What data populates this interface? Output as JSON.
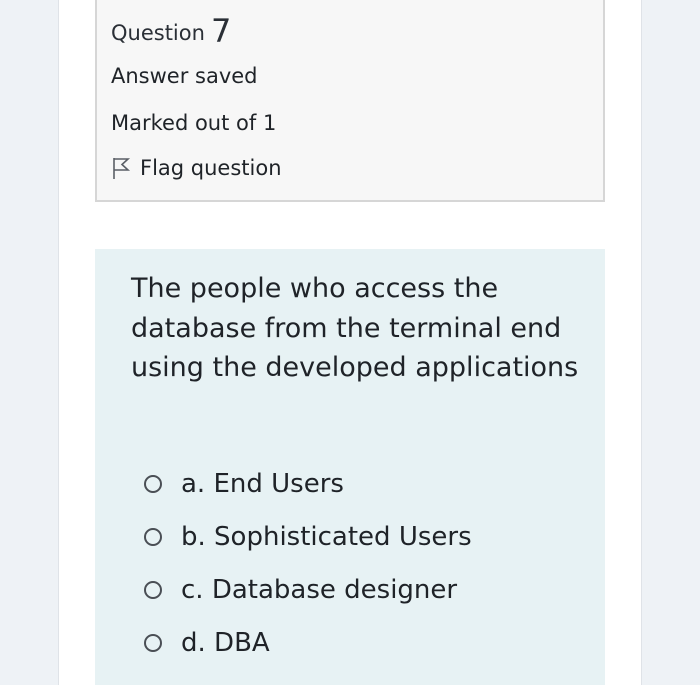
{
  "question_info": {
    "label": "Question",
    "number": "7",
    "state": "Answer saved",
    "grade": "Marked out of 1",
    "flag_label": "Flag question"
  },
  "question": {
    "text": "The people who access the database from the terminal end using the developed applications",
    "options": [
      {
        "letter": "a.",
        "text": "End Users",
        "selected": false
      },
      {
        "letter": "b.",
        "text": "Sophisticated Users",
        "selected": false
      },
      {
        "letter": "c.",
        "text": "Database designer",
        "selected": false
      },
      {
        "letter": "d.",
        "text": "DBA",
        "selected": false
      }
    ]
  },
  "icons": {
    "flag": "flag-outline-icon",
    "radio": "radio-unchecked-icon"
  },
  "colors": {
    "page_background": "#eef2f6",
    "info_box_background": "#f7f7f7",
    "question_box_background": "#e7f2f4",
    "text": "#1f2328"
  }
}
